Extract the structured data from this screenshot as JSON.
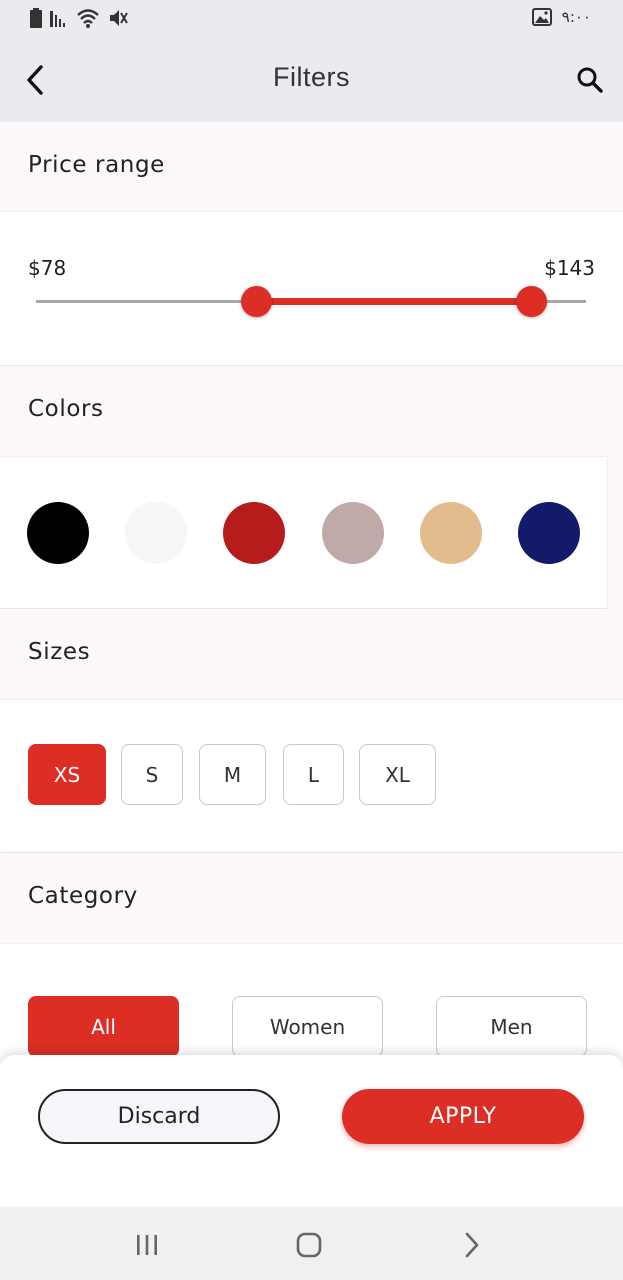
{
  "status_bar": {
    "time": "٩:٠٠",
    "icons": [
      "battery-icon",
      "signal-icon",
      "wifi-icon",
      "mute-icon",
      "gallery-icon"
    ]
  },
  "header": {
    "title": "Filters",
    "back_icon": "chevron-left-icon",
    "search_icon": "search-icon"
  },
  "price": {
    "label": "Price range",
    "min_label": "$78",
    "max_label": "$143",
    "range_low_fraction": 0.4,
    "range_high_fraction": 0.9
  },
  "colors": {
    "label": "Colors",
    "swatches": [
      "#000000",
      "#f6f6f6",
      "#b71c1c",
      "#bfaaa7",
      "#e2bc8c",
      "#131a6a"
    ]
  },
  "sizes": {
    "label": "Sizes",
    "options": [
      "XS",
      "S",
      "M",
      "L",
      "XL"
    ],
    "selected": "XS"
  },
  "category": {
    "label": "Category",
    "options": [
      "All",
      "Women",
      "Men"
    ],
    "selected": "All"
  },
  "actions": {
    "discard": "Discard",
    "apply": "APPLY"
  },
  "accent_color": "#dc2e25"
}
